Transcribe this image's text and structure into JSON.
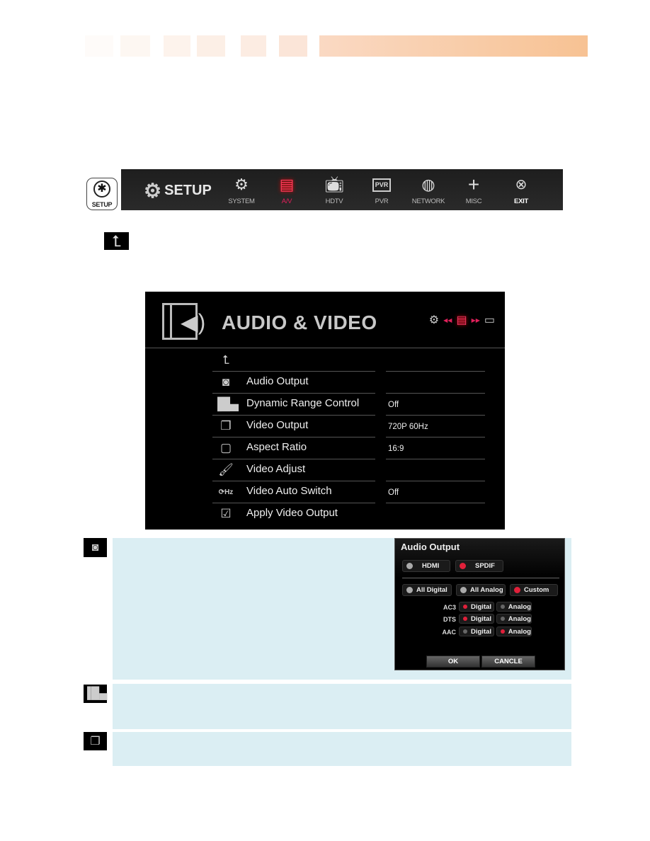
{
  "header_band": {
    "colors": [
      "#fefaf8",
      "#fdf3ed",
      "#fde8db",
      "#f8c597"
    ]
  },
  "setup_badge": {
    "label": "SETUP",
    "icon": "gear-icon"
  },
  "menubar": {
    "title": "SETUP",
    "items": [
      {
        "label": "SYSTEM",
        "icon": "gears-icon"
      },
      {
        "label": "A/V",
        "icon": "film-speaker-icon",
        "active": true
      },
      {
        "label": "HDTV",
        "icon": "tv-icon"
      },
      {
        "label": "PVR",
        "icon": "pvr-film-icon"
      },
      {
        "label": "NETWORK",
        "icon": "globe-icon"
      },
      {
        "label": "MISC",
        "icon": "plus-icon"
      },
      {
        "label": "EXIT",
        "icon": "close-circle-icon"
      }
    ],
    "accent": "#e0205a"
  },
  "av_panel": {
    "title": "AUDIO & VIDEO",
    "rows": [
      {
        "label": "",
        "icon": "back-arrow-icon",
        "value": ""
      },
      {
        "label": "Audio Output",
        "icon": "speaker-icon",
        "value": ""
      },
      {
        "label": "Dynamic Range Control",
        "icon": "bars-icon",
        "value": "Off"
      },
      {
        "label": "Video Output",
        "icon": "windows-icon",
        "value": "720P 60Hz"
      },
      {
        "label": "Aspect Ratio",
        "icon": "aspect-ratio-icon",
        "value": "16:9"
      },
      {
        "label": "Video Adjust",
        "icon": "brush-icon",
        "value": ""
      },
      {
        "label": "Video Auto Switch",
        "icon": "hz-icon",
        "value": "Off"
      },
      {
        "label": "Apply Video Output",
        "icon": "check-monitor-icon",
        "value": ""
      }
    ]
  },
  "audio_dialog": {
    "title": "Audio Output",
    "outputs": [
      {
        "label": "HDMI",
        "selected": false
      },
      {
        "label": "SPDIF",
        "selected": true
      }
    ],
    "modes": [
      {
        "label": "All Digital",
        "selected": false
      },
      {
        "label": "All Analog",
        "selected": false
      },
      {
        "label": "Custom",
        "selected": true
      }
    ],
    "codecs": [
      {
        "name": "AC3",
        "digital_label": "Digital",
        "analog_label": "Analog",
        "selected": "Digital"
      },
      {
        "name": "DTS",
        "digital_label": "Digital",
        "analog_label": "Analog",
        "selected": "Digital"
      },
      {
        "name": "AAC",
        "digital_label": "Digital",
        "analog_label": "Analog",
        "selected": "Analog"
      }
    ],
    "ok_label": "OK",
    "cancel_label": "CANCLE"
  }
}
